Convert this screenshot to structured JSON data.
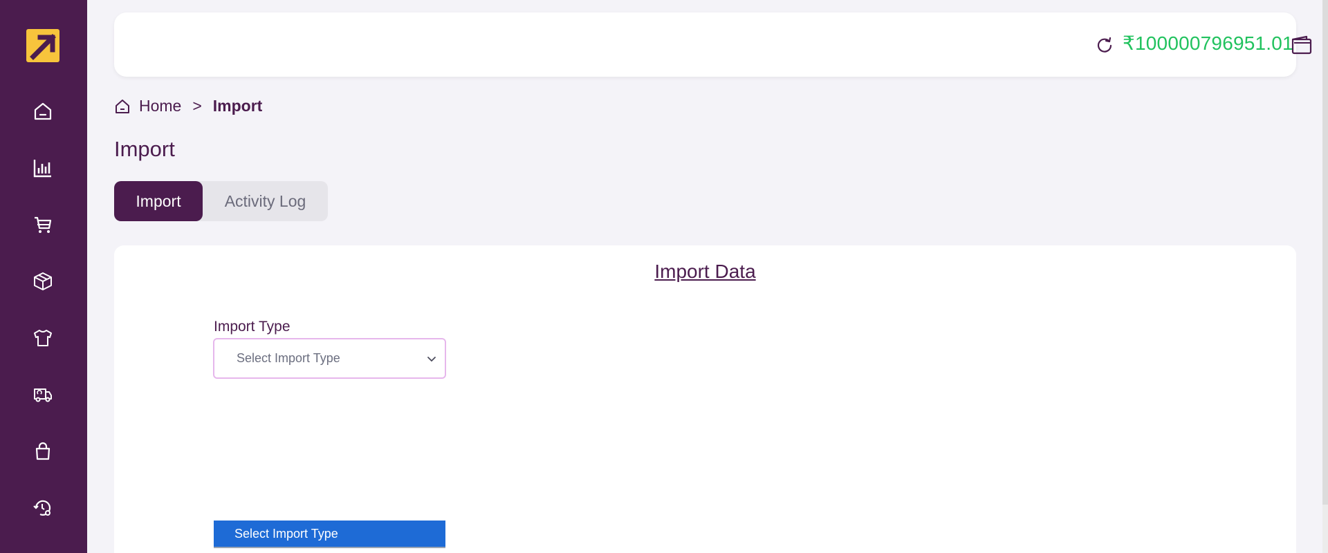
{
  "header": {
    "balance": "₹100000796951.01"
  },
  "breadcrumb": {
    "home": "Home",
    "separator": ">",
    "current": "Import"
  },
  "page": {
    "title": "Import"
  },
  "tabs": [
    {
      "label": "Import",
      "active": true
    },
    {
      "label": "Activity Log",
      "active": false
    }
  ],
  "card": {
    "title": "Import Data",
    "field_label": "Import Type",
    "select_value": "Select Import Type",
    "dropdown_options": [
      "Select Import Type"
    ]
  },
  "sidebar": {
    "items": [
      "home-icon",
      "analytics-icon",
      "cart-icon",
      "box-icon",
      "tshirt-icon",
      "truck-icon",
      "bag-icon",
      "history-settings-icon"
    ]
  },
  "colors": {
    "sidebar": "#4b1c4e",
    "accent": "#4b1c4e",
    "balance": "#21c25e",
    "logo": "#f7c43c",
    "dropdown_highlight": "#1e6bd6"
  }
}
